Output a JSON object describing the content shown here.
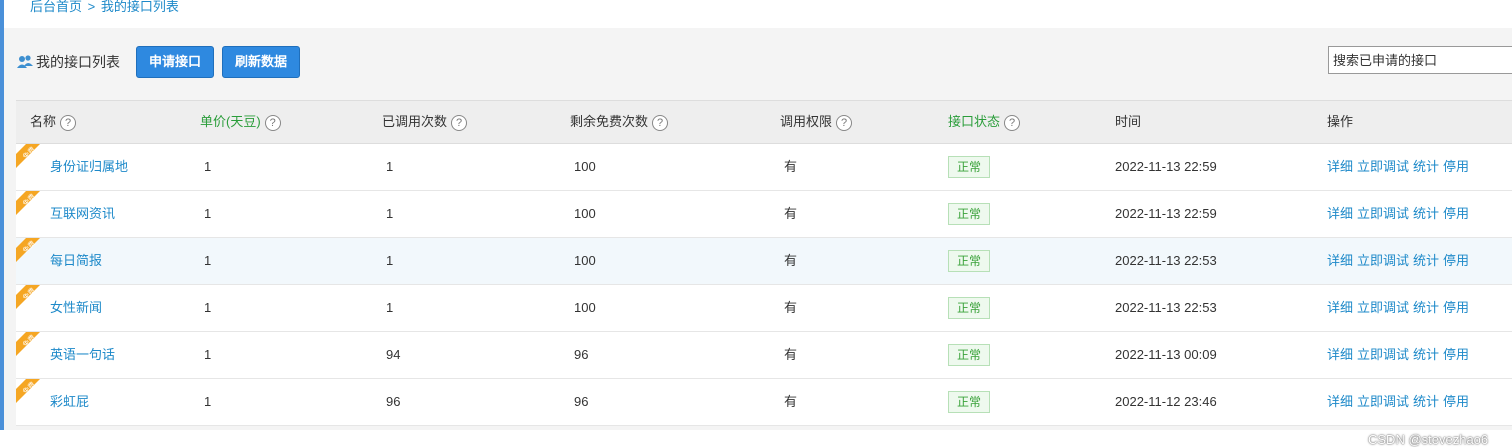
{
  "breadcrumb": {
    "home": "后台首页",
    "separator": ">",
    "current": "我的接口列表"
  },
  "panel": {
    "title": "我的接口列表",
    "apply_button": "申请接口",
    "refresh_button": "刷新数据",
    "search_placeholder": "搜索已申请的接口"
  },
  "table": {
    "headers": {
      "name": "名称",
      "price": "单价(天豆)",
      "used": "已调用次数",
      "free_left": "剩余免费次数",
      "permission": "调用权限",
      "status": "接口状态",
      "time": "时间",
      "ops": "操作"
    },
    "help_glyph": "?",
    "ribbon_text": "免费",
    "actions": {
      "detail": "详细",
      "debug": "立即调试",
      "stats": "统计",
      "disable": "停用"
    },
    "rows": [
      {
        "name": "身份证归属地",
        "price": "1",
        "used": "1",
        "free_left": "100",
        "permission": "有",
        "status": "正常",
        "time": "2022-11-13 22:59"
      },
      {
        "name": "互联网资讯",
        "price": "1",
        "used": "1",
        "free_left": "100",
        "permission": "有",
        "status": "正常",
        "time": "2022-11-13 22:59"
      },
      {
        "name": "每日简报",
        "price": "1",
        "used": "1",
        "free_left": "100",
        "permission": "有",
        "status": "正常",
        "time": "2022-11-13 22:53"
      },
      {
        "name": "女性新闻",
        "price": "1",
        "used": "1",
        "free_left": "100",
        "permission": "有",
        "status": "正常",
        "time": "2022-11-13 22:53"
      },
      {
        "name": "英语一句话",
        "price": "1",
        "used": "94",
        "free_left": "96",
        "permission": "有",
        "status": "正常",
        "time": "2022-11-13 00:09"
      },
      {
        "name": "彩虹屁",
        "price": "1",
        "used": "96",
        "free_left": "96",
        "permission": "有",
        "status": "正常",
        "time": "2022-11-12 23:46"
      }
    ]
  },
  "watermark": "CSDN @stevezhao6",
  "colors": {
    "accent": "#2e89e0",
    "link": "#1d89c9",
    "ribbon": "#f5a623",
    "status_green": "#3aa23a"
  },
  "icons": {
    "title": "users-icon",
    "help": "question-circle-icon",
    "ribbon": "free-ribbon-icon"
  }
}
